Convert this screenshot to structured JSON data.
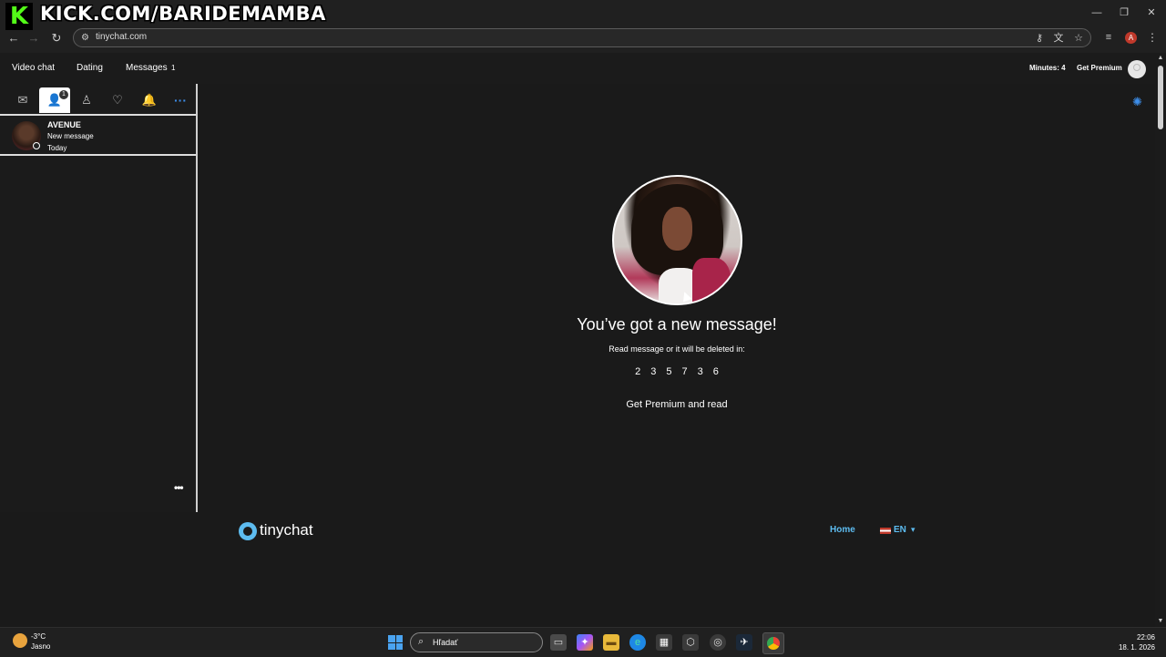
{
  "overlay": {
    "stream_text": "KICK.COM/BARIDEMAMBA",
    "kick_logo_letter": "K"
  },
  "browser": {
    "url": "tinychat.com",
    "profile_initial": "A"
  },
  "header": {
    "nav": [
      "Video chat",
      "Dating",
      "Messages"
    ],
    "messages_badge": "1",
    "minutes": "Minutes: 4",
    "get_premium": "Get Premium"
  },
  "sidebar": {
    "tab_badge": "1",
    "conversation": {
      "name": "AVENUE",
      "preview": "New message",
      "time": "Today"
    },
    "more": "•••"
  },
  "main": {
    "title": "You’ve got a new message!",
    "countdown_label": "Read message or it will be deleted in:",
    "countdown_digits": [
      "2",
      "3",
      "5",
      "7",
      "3",
      "6"
    ],
    "premium_read": "Get Premium and read"
  },
  "footer": {
    "logo_text": "tinychat",
    "home": "Home",
    "language": "EN"
  },
  "taskbar": {
    "weather_temp": "-3°C",
    "weather_condition": "Jasno",
    "search_placeholder": "Hľadať",
    "time": "22:06",
    "date": "18. 1. 2026"
  },
  "colors": {
    "accent_blue": "#3d8eea",
    "link_blue": "#5dbcf0",
    "kick_green": "#53fc18",
    "background": "#1a1a1a"
  }
}
